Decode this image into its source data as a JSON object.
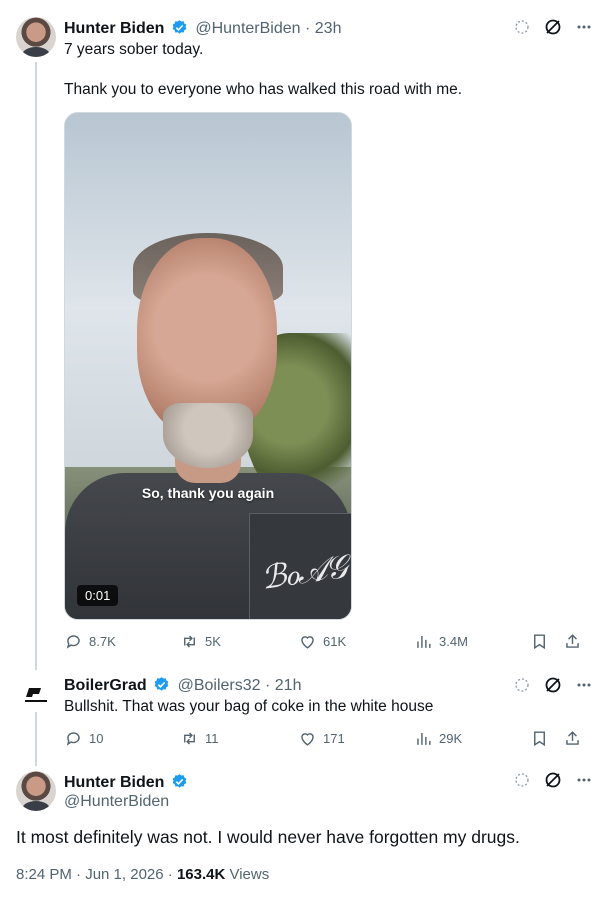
{
  "tweet1": {
    "name": "Hunter Biden",
    "handle": "@HunterBiden",
    "time": "· 23h",
    "line1": "7 years sober today.",
    "line2": "Thank you to everyone who has walked this road with me.",
    "video_caption": "So, thank you again",
    "video_time": "0:01",
    "stats": {
      "replies": "8.7K",
      "reposts": "5K",
      "likes": "61K",
      "views": "3.4M"
    }
  },
  "tweet2": {
    "name": "BoilerGrad",
    "handle": "@Boilers32",
    "time": "· 21h",
    "text": "Bullshit. That was your bag of coke in the white house",
    "stats": {
      "replies": "10",
      "reposts": "11",
      "likes": "171",
      "views": "29K"
    }
  },
  "tweet3": {
    "name": "Hunter Biden",
    "handle": "@HunterBiden",
    "text": "It most definitely was not. I would never have forgotten my drugs.",
    "timestamp": "8:24 PM · Jun 1, 2026 ·",
    "views_count": "163.4K",
    "views_label": "Views"
  },
  "colors": {
    "verified": "#1d9bf0",
    "muted": "#536471",
    "border": "#cfd9de"
  },
  "icons": [
    "verified-badge-icon",
    "grok-icon",
    "slash-circle-icon",
    "more-icon",
    "reply-icon",
    "repost-icon",
    "like-icon",
    "views-icon",
    "bookmark-icon",
    "share-icon"
  ]
}
